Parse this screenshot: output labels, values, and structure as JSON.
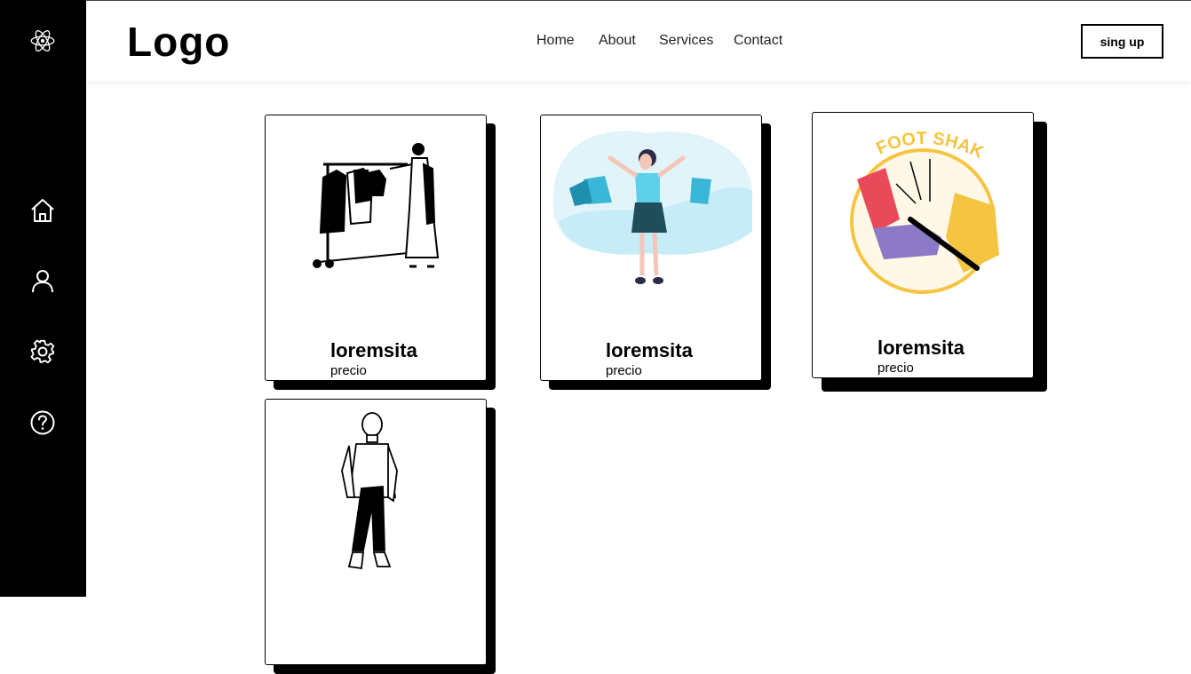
{
  "header": {
    "logo": "Logo",
    "nav": [
      "Home",
      "About",
      "Services",
      "Contact"
    ],
    "signup_label": "sing up"
  },
  "sidebar": {
    "items": [
      {
        "icon": "react-logo-icon"
      },
      {
        "icon": "home-icon"
      },
      {
        "icon": "user-icon"
      },
      {
        "icon": "settings-icon"
      },
      {
        "icon": "help-icon"
      }
    ]
  },
  "cards": [
    {
      "title": "loremsita",
      "price": "precio",
      "illustration": "clothing-rack-illustration"
    },
    {
      "title": "loremsita",
      "price": "precio",
      "illustration": "shopping-woman-illustration"
    },
    {
      "title": "loremsita",
      "price": "precio",
      "illustration": "foot-shake-illustration",
      "badge_text": "FOOT SHAKE"
    },
    {
      "title": "",
      "price": "",
      "illustration": "standing-person-illustration"
    }
  ],
  "colors": {
    "sidebar_bg": "#000000",
    "accent_yellow": "#f5c542",
    "accent_teal": "#3ab6d6"
  }
}
